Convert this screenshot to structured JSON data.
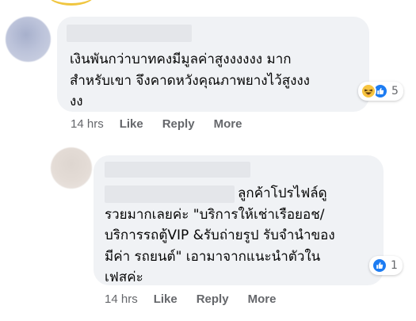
{
  "comments": [
    {
      "author": "",
      "text": "เงินพันกว่าบาทคงมีมูลค่าสูงงงงงง มาก\nสำหรับเขา จึงคาดหวังคุณภาพยางไว้สูงงง\nงง",
      "reactions": {
        "icons": [
          "haha",
          "like"
        ],
        "count": "5"
      },
      "time": "14 hrs",
      "actions": {
        "like": "Like",
        "reply": "Reply",
        "more": "More"
      }
    },
    {
      "author": "",
      "text": "ลูกค้าโปรไฟล์ดู\nรวยมากเลยค่ะ \"บริการให้เช่าเรือยอช/\nบริการรถตู้VIP &รับถ่ายรูป รับจำนำของ\nมีค่า รถยนต์\" เอามาจากแนะนำตัวใน\nเฟสค่ะ",
      "reactions": {
        "icons": [
          "like"
        ],
        "count": "1"
      },
      "time": "14 hrs",
      "actions": {
        "like": "Like",
        "reply": "Reply",
        "more": "More"
      }
    }
  ],
  "colors": {
    "bubble": "#f0f2f5",
    "meta_text": "#65676b",
    "like_blue": "#1d7cf2",
    "haha_yellow": "#f7c440"
  }
}
